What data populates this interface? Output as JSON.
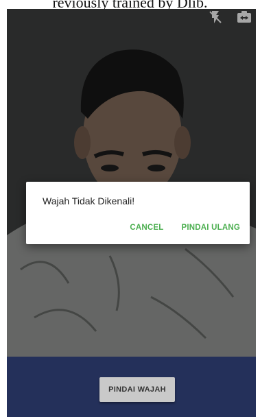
{
  "caption": "reviously trained by Dlib.",
  "top_bar": {
    "icons": [
      "flash-off-icon",
      "switch-camera-icon"
    ]
  },
  "dialog": {
    "message": "Wajah Tidak Dikenali!",
    "cancel_label": "CANCEL",
    "rescan_label": "PINDAI ULANG"
  },
  "bottom": {
    "scan_label": "PINDAI WAJAH"
  },
  "colors": {
    "accent_green": "#4caf50",
    "bottom_bar": "#24305a",
    "button_grey": "#c9c9c9"
  }
}
